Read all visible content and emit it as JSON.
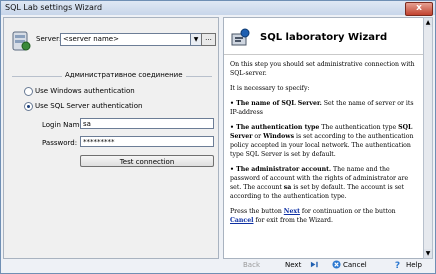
{
  "window": {
    "title": "SQL Lab settings Wizard",
    "close_glyph": "x"
  },
  "left_panel": {
    "server_label": "Server:",
    "server_value": "<server name>",
    "browse_label": "...",
    "group_caption": "Административное соединение",
    "auth_windows": "Use Windows authentication",
    "auth_sql": "Use SQL Server authentication",
    "login_label": "Login Name:",
    "login_value": "sa",
    "password_label": "Password:",
    "password_value": "*********",
    "test_button": "Test connection"
  },
  "right_panel": {
    "title": "SQL laboratory Wizard",
    "para1": "On this step you should set administrative connection with SQL-server.",
    "para2": "It is necessary to specify:",
    "item1_bold": "• The name of SQL Server.",
    "item1_text": " Set the name of server or its IP-address",
    "item2_bold": "• The authentication type",
    "item2_text1": " The authentication type ",
    "item2_bold2": "SQL Server",
    "item2_text2": " or ",
    "item2_bold3": "Windows",
    "item2_text3": " is set according to the authentication policy accepted in your local network. The authentication type SQL Server is set by default.",
    "item3_bold": "• The administrator account.",
    "item3_text1": " The name and the password of account with the rights of administrator are set. The account ",
    "item3_bold2": "sa",
    "item3_text2": " is set by default. The account is set according to the authentication type.",
    "footer_text1": "Press the button ",
    "footer_link1": "Next",
    "footer_text2": " for continuation or the button ",
    "footer_link2": "Cancel",
    "footer_text3": " for exit from the Wizard."
  },
  "buttons": {
    "back": "Back",
    "next": "Next",
    "cancel": "Cancel",
    "help": "Help"
  },
  "icons": {
    "next": "arrow-right-icon",
    "cancel": "cancel-icon",
    "help": "help-question-icon",
    "server": "server-database-icon",
    "wizard": "wizard-icon"
  },
  "colors": {
    "link": "#0d2fa3",
    "disabled": "#9a9a9a",
    "accent": "#1a3e7a"
  }
}
